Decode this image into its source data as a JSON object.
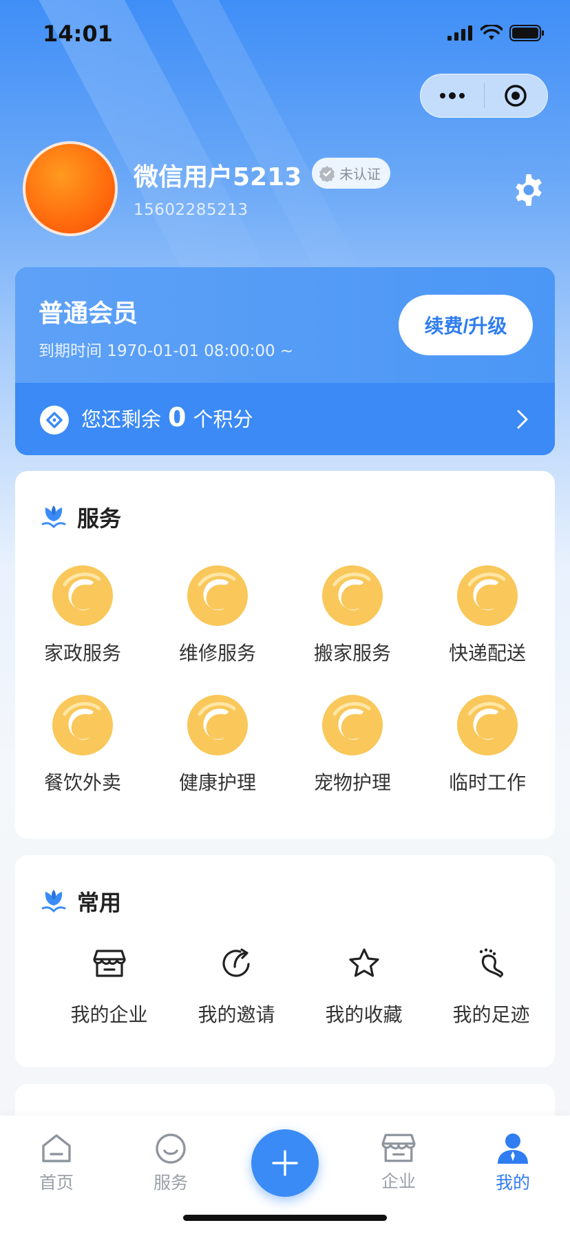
{
  "status_bar": {
    "time": "14:01"
  },
  "profile": {
    "username": "微信用户5213",
    "cert_status": "未认证",
    "phone": "15602285213"
  },
  "membership": {
    "level": "普通会员",
    "expire_text": "到期时间 1970-01-01 08:00:00 ~",
    "renew_label": "续费/升级",
    "points_prefix": "您还剩余",
    "points_value": "0",
    "points_suffix": "个积分"
  },
  "services": {
    "title": "服务",
    "items": [
      {
        "label": "家政服务"
      },
      {
        "label": "维修服务"
      },
      {
        "label": "搬家服务"
      },
      {
        "label": "快递配送"
      },
      {
        "label": "餐饮外卖"
      },
      {
        "label": "健康护理"
      },
      {
        "label": "宠物护理"
      },
      {
        "label": "临时工作"
      }
    ]
  },
  "common": {
    "title": "常用",
    "items": [
      {
        "label": "我的企业",
        "icon": "store-icon"
      },
      {
        "label": "我的邀请",
        "icon": "share-icon"
      },
      {
        "label": "我的收藏",
        "icon": "star-icon"
      },
      {
        "label": "我的足迹",
        "icon": "footprint-icon"
      }
    ]
  },
  "tabbar": {
    "tabs": [
      {
        "label": "首页",
        "icon": "home-icon"
      },
      {
        "label": "服务",
        "icon": "smile-icon"
      },
      {
        "label": "企业",
        "icon": "store-icon"
      },
      {
        "label": "我的",
        "icon": "user-icon",
        "active": true
      }
    ],
    "fab_icon": "plus-icon"
  },
  "colors": {
    "accent": "#3a8bf6",
    "service_logo": "#f9c75a"
  }
}
